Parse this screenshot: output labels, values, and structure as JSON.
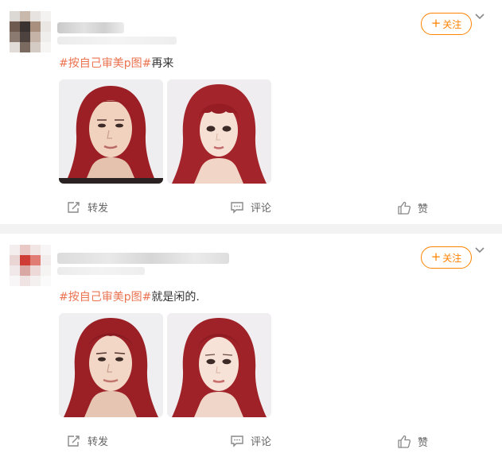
{
  "posts": [
    {
      "follow_label": "关注",
      "follow_plus": "+",
      "hashtag": "#按自己审美p图#",
      "text": "再来",
      "photos": [
        {
          "icon": "portrait-photo-original"
        },
        {
          "icon": "portrait-photo-edited"
        }
      ],
      "actions": {
        "repost": "转发",
        "comment": "评论",
        "like": "赞"
      }
    },
    {
      "follow_label": "关注",
      "follow_plus": "+",
      "hashtag": "#按自己审美p图#",
      "text": "就是闲的.",
      "photos": [
        {
          "icon": "portrait-photo-original"
        },
        {
          "icon": "portrait-photo-edited"
        }
      ],
      "actions": {
        "repost": "转发",
        "comment": "评论",
        "like": "赞"
      }
    }
  ],
  "colors": {
    "accent": "#ff8200",
    "hashtag": "#eb7350",
    "separator": "#f2f2f2",
    "hair": "#9b1f24"
  }
}
